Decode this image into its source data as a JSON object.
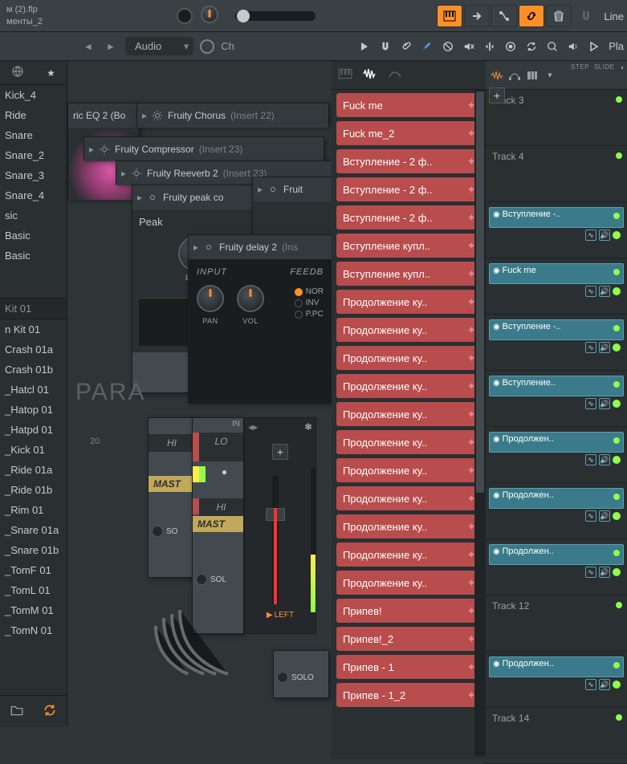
{
  "title": {
    "line1": "м (2).flp",
    "line2": "менты_2"
  },
  "top_right": {
    "line_label": "Line"
  },
  "sec": {
    "audio": "Audio",
    "ch": "Ch",
    "pla": "Pla"
  },
  "browser": {
    "items1": [
      "Kick_4",
      "Ride",
      "Snare",
      "Snare_2",
      "Snare_3",
      "Snare_4",
      "sic",
      "Basic",
      "Basic"
    ],
    "cat": "Kit 01",
    "items2": [
      "n Kit 01",
      "Crash 01a",
      "Crash 01b",
      "_Hatcl 01",
      "_Hatop 01",
      "_Hatpd 01",
      "_Kick 01",
      "_Ride 01a",
      "_Ride 01b",
      "_Rim 01",
      "_Snare 01a",
      "_Snare 01b",
      "_TomF 01",
      "_TomL 01",
      "_TomM 01",
      "_TomN 01"
    ]
  },
  "plugins": {
    "eq": "ric EQ 2 (Bo",
    "chorus": {
      "name": "Fruity Chorus",
      "insert": "(Insert 22)"
    },
    "comp": {
      "name": "Fruity Compressor",
      "insert": "(Insert 23)"
    },
    "reverb": {
      "name": "Fruity Reeverb 2",
      "insert": "(Insert 23)"
    },
    "peakc": {
      "name": "Fruity peak co"
    },
    "fruit": "Fruit",
    "delay": {
      "name": "Fruity delay 2",
      "insert": "(Ins"
    },
    "peak": {
      "title": "Peak",
      "base": "BASE"
    },
    "delay_panel": {
      "input": "INPUT",
      "feedb": "FEEDB",
      "pan": "PAN",
      "vol": "VOL",
      "nor": "NOR",
      "inv": "INV",
      "ppc": "P.PC"
    }
  },
  "mixer": {
    "in": "IN",
    "hi": "HI",
    "lo": "LO",
    "hi2": "HI",
    "master": "MAST",
    "solo": "SO",
    "solo2": "SOL",
    "solo3": "SOLO",
    "left": "LEFT",
    "para": "PARA",
    "twenty": "20"
  },
  "patterns": [
    "Fuck me",
    "Fuck me_2",
    "Вступление - 2 ф..",
    "Вступление - 2 ф..",
    "Вступление - 2 ф..",
    "Вступление купл..",
    "Вступление купл..",
    "Продолжение ку..",
    "Продолжение ку..",
    "Продолжение ку..",
    "Продолжение ку..",
    "Продолжение ку..",
    "Продолжение ку..",
    "Продолжение ку..",
    "Продолжение ку..",
    "Продолжение ку..",
    "Продолжение ку..",
    "Продолжение ку..",
    "Припев!",
    "Припев!_2",
    "Припев - 1",
    "Припев - 1_2"
  ],
  "playlist": {
    "step": "STEP",
    "slide": "SLIDE",
    "tracks": [
      {
        "label": "Track 3",
        "clips": []
      },
      {
        "label": "Track 4",
        "clips": []
      },
      {
        "label": "",
        "clips": [
          {
            "name": "Вступление -.."
          }
        ]
      },
      {
        "label": "",
        "clips": [
          {
            "name": "Fuck me"
          }
        ]
      },
      {
        "label": "",
        "clips": [
          {
            "name": "Вступление -.."
          }
        ]
      },
      {
        "label": "",
        "clips": [
          {
            "name": "Вступление.."
          }
        ]
      },
      {
        "label": "",
        "clips": [
          {
            "name": "Продолжен.."
          }
        ]
      },
      {
        "label": "",
        "clips": [
          {
            "name": "Продолжен.."
          }
        ]
      },
      {
        "label": "",
        "clips": [
          {
            "name": "Продолжен.."
          }
        ]
      },
      {
        "label": "Track 12",
        "clips": []
      },
      {
        "label": "",
        "clips": [
          {
            "name": "Продолжен.."
          }
        ]
      },
      {
        "label": "Track 14",
        "clips": []
      }
    ]
  }
}
